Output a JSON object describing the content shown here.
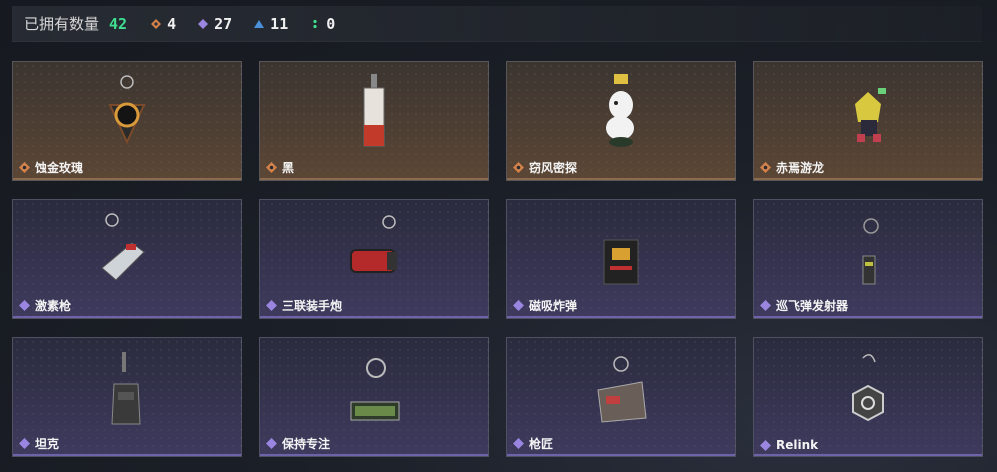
{
  "header": {
    "owned_label": "已拥有数量",
    "owned_count": "42",
    "stats": [
      {
        "icon": "orange-diamond-icon",
        "value": "4",
        "color": "#d4824a"
      },
      {
        "icon": "purple-diamond-icon",
        "value": "27",
        "color": "#9a86e0"
      },
      {
        "icon": "blue-triangle-icon",
        "value": "11",
        "color": "#4a90d9"
      },
      {
        "icon": "green-dots-icon",
        "value": "0",
        "color": "#3ee08f"
      }
    ]
  },
  "items": [
    {
      "name": "蚀金玫瑰",
      "rarity": "orange"
    },
    {
      "name": "黑",
      "rarity": "orange"
    },
    {
      "name": "窃风密探",
      "rarity": "orange"
    },
    {
      "name": "赤焉游龙",
      "rarity": "orange"
    },
    {
      "name": "激素枪",
      "rarity": "purple"
    },
    {
      "name": "三联装手炮",
      "rarity": "purple"
    },
    {
      "name": "磁吸炸弹",
      "rarity": "purple"
    },
    {
      "name": "巡飞弹发射器",
      "rarity": "purple"
    },
    {
      "name": "坦克",
      "rarity": "purple"
    },
    {
      "name": "保持专注",
      "rarity": "purple"
    },
    {
      "name": "枪匠",
      "rarity": "purple"
    },
    {
      "name": "Relink",
      "rarity": "purple"
    }
  ]
}
